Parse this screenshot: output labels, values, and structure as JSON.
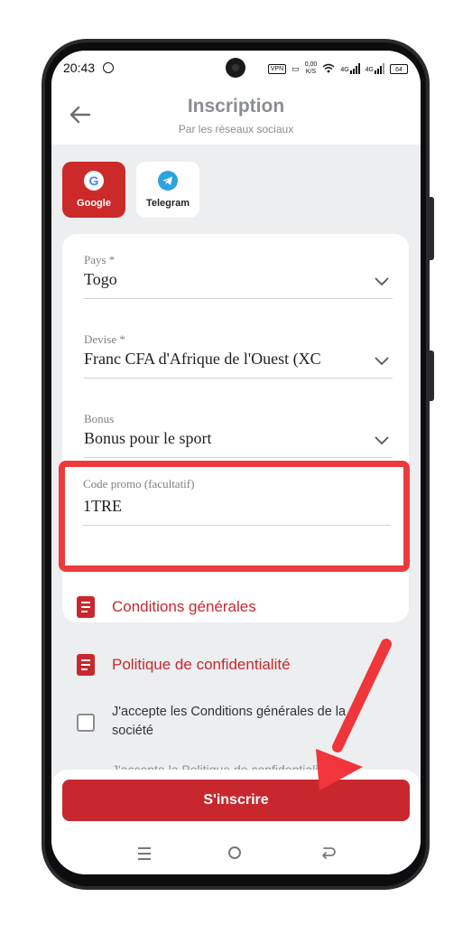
{
  "status_bar": {
    "time": "20:43",
    "vpn": "VPN",
    "speed_top": "0,00",
    "speed_bottom": "K/S",
    "net1": "4G",
    "net2": "4G",
    "battery": "64"
  },
  "header": {
    "title": "Inscription",
    "subtitle": "Par les réseaux sociaux"
  },
  "social": {
    "google_label": "Google",
    "google_icon": "G",
    "telegram_label": "Telegram"
  },
  "form": {
    "country": {
      "label": "Pays *",
      "value": "Togo"
    },
    "currency": {
      "label": "Devise *",
      "value": "Franc CFA d'Afrique de l'Ouest (XC"
    },
    "bonus": {
      "label": "Bonus",
      "value": "Bonus pour le sport"
    },
    "promo": {
      "label": "Code promo (facultatif)",
      "value": "1TRE"
    }
  },
  "links": {
    "terms": "Conditions générales",
    "privacy": "Politique de confidentialité"
  },
  "consent": {
    "terms_text": "J'accepte les Conditions générales de la société",
    "privacy_text_partial": "J'accepte la Politique de confidentialité"
  },
  "submit_label": "S'inscrire",
  "colors": {
    "brand_red": "#c8282d",
    "highlight_red": "#ee3a3a",
    "telegram_blue": "#2ea4dd"
  }
}
